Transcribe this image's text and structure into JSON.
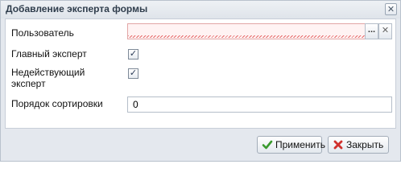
{
  "dialog": {
    "title": "Добавление эксперта формы",
    "close_icon": "close-icon"
  },
  "form": {
    "user_label": "Пользователь",
    "user_value": "",
    "browse_label": "...",
    "clear_label": "✕",
    "main_expert_label": "Главный эксперт",
    "main_expert_checked": true,
    "inactive_expert_label_line1": "Недействующий",
    "inactive_expert_label_line2": "эксперт",
    "inactive_expert_checked": true,
    "sort_order_label": "Порядок сортировки",
    "sort_order_value": "0"
  },
  "buttons": {
    "apply_label": "Применить",
    "apply_icon": "check-icon",
    "close_label": "Закрыть",
    "close_icon": "cross-icon"
  },
  "colors": {
    "error_border": "#e2a6a6",
    "error_background": "#fff3f3",
    "apply_icon_color": "#3a9a2e",
    "close_icon_color": "#d0312d"
  }
}
